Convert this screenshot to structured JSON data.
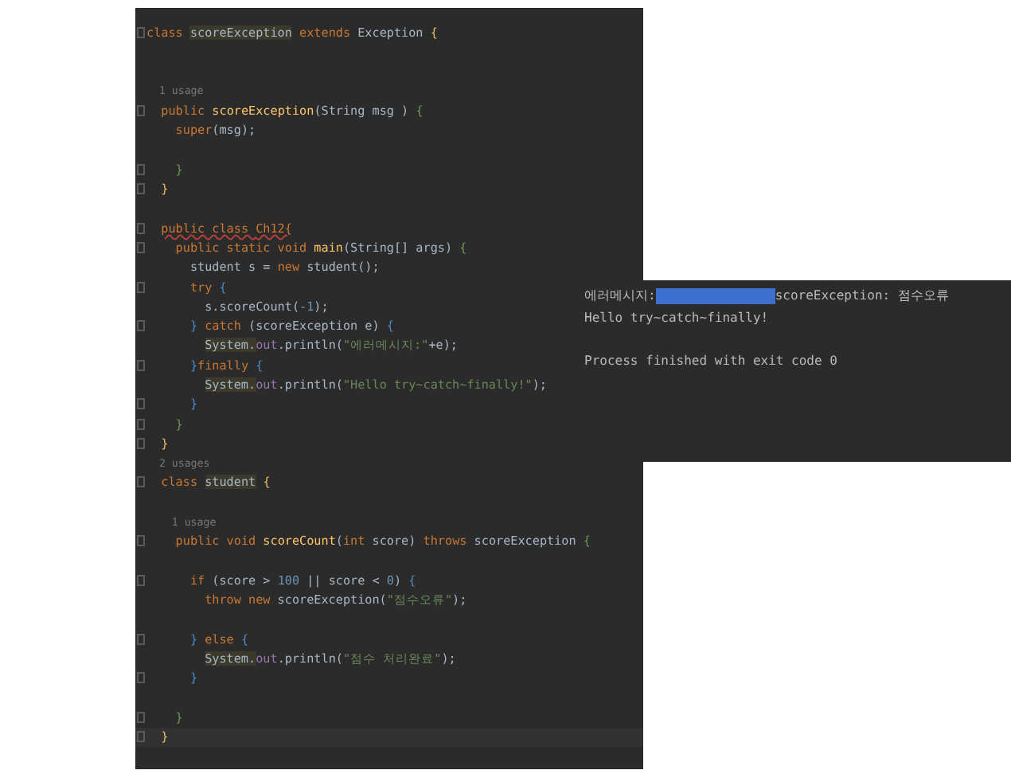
{
  "editor": {
    "lines": [
      {
        "kind": "code",
        "fold": true,
        "tokens": [
          {
            "text": "class ",
            "kind": "kw"
          },
          {
            "text": "scoreException",
            "kind": "mark"
          },
          {
            "text": " extends ",
            "kind": "kw"
          },
          {
            "text": "Exception ",
            "kind": "plain"
          },
          {
            "text": "{",
            "kind": "brace1"
          }
        ]
      },
      {
        "kind": "blank"
      },
      {
        "kind": "blank"
      },
      {
        "kind": "hint",
        "tokens": [
          {
            "text": "  1 usage",
            "kind": "hint"
          }
        ]
      },
      {
        "kind": "code",
        "fold": true,
        "tokens": [
          {
            "text": "  public ",
            "kind": "kw"
          },
          {
            "text": "scoreException",
            "kind": "fn"
          },
          {
            "text": "(String msg ) ",
            "kind": "plain"
          },
          {
            "text": "{",
            "kind": "brace2"
          }
        ]
      },
      {
        "kind": "code",
        "tokens": [
          {
            "text": "    super",
            "kind": "kw"
          },
          {
            "text": "(msg);",
            "kind": "plain"
          }
        ]
      },
      {
        "kind": "blank"
      },
      {
        "kind": "code",
        "fold": true,
        "tokens": [
          {
            "text": "    }",
            "kind": "brace2"
          }
        ]
      },
      {
        "kind": "code",
        "fold": true,
        "tokens": [
          {
            "text": "  }",
            "kind": "brace1"
          }
        ]
      },
      {
        "kind": "blank"
      },
      {
        "kind": "code",
        "fold": true,
        "tokens": [
          {
            "text": "  public class ",
            "kind": "err"
          },
          {
            "text": "Ch12{",
            "kind": "err"
          }
        ]
      },
      {
        "kind": "code",
        "fold": true,
        "tokens": [
          {
            "text": "    public static void ",
            "kind": "kw"
          },
          {
            "text": "main",
            "kind": "fn"
          },
          {
            "text": "(String[] args) ",
            "kind": "plain"
          },
          {
            "text": "{",
            "kind": "brace2"
          }
        ]
      },
      {
        "kind": "code",
        "tokens": [
          {
            "text": "      student s = ",
            "kind": "plain"
          },
          {
            "text": "new ",
            "kind": "kw"
          },
          {
            "text": "student();",
            "kind": "plain"
          }
        ]
      },
      {
        "kind": "code",
        "fold": true,
        "tokens": [
          {
            "text": "      try ",
            "kind": "kw"
          },
          {
            "text": "{",
            "kind": "brace3"
          }
        ]
      },
      {
        "kind": "code",
        "tokens": [
          {
            "text": "        s.scoreCount(",
            "kind": "plain"
          },
          {
            "text": "-1",
            "kind": "num"
          },
          {
            "text": ");",
            "kind": "plain"
          }
        ]
      },
      {
        "kind": "code",
        "fold": true,
        "tokens": [
          {
            "text": "      } ",
            "kind": "brace3"
          },
          {
            "text": "catch ",
            "kind": "kw"
          },
          {
            "text": "(scoreException e) ",
            "kind": "plain"
          },
          {
            "text": "{",
            "kind": "brace3"
          }
        ]
      },
      {
        "kind": "code",
        "tokens": [
          {
            "text": "        System.",
            "kind": "mark"
          },
          {
            "text": "out",
            "kind": "field"
          },
          {
            "text": ".println(",
            "kind": "plain"
          },
          {
            "text": "\"에러메시지:\"",
            "kind": "str"
          },
          {
            "text": "+e);",
            "kind": "plain"
          }
        ]
      },
      {
        "kind": "code",
        "fold": true,
        "tokens": [
          {
            "text": "      }",
            "kind": "brace3"
          },
          {
            "text": "finally ",
            "kind": "kw"
          },
          {
            "text": "{",
            "kind": "brace3"
          }
        ]
      },
      {
        "kind": "code",
        "tokens": [
          {
            "text": "        System.",
            "kind": "mark"
          },
          {
            "text": "out",
            "kind": "field"
          },
          {
            "text": ".println(",
            "kind": "plain"
          },
          {
            "text": "\"Hello try~catch~finally!\"",
            "kind": "str"
          },
          {
            "text": ");",
            "kind": "plain"
          }
        ]
      },
      {
        "kind": "code",
        "fold": true,
        "tokens": [
          {
            "text": "      }",
            "kind": "brace3"
          }
        ]
      },
      {
        "kind": "code",
        "fold": true,
        "tokens": [
          {
            "text": "    }",
            "kind": "brace2"
          }
        ]
      },
      {
        "kind": "code",
        "fold": true,
        "tokens": [
          {
            "text": "  }",
            "kind": "brace1"
          }
        ]
      },
      {
        "kind": "hint",
        "tokens": [
          {
            "text": "  2 usages",
            "kind": "hint"
          }
        ]
      },
      {
        "kind": "code",
        "fold": true,
        "tokens": [
          {
            "text": "  class ",
            "kind": "kw"
          },
          {
            "text": "student",
            "kind": "mark"
          },
          {
            "text": " {",
            "kind": "brace1"
          }
        ]
      },
      {
        "kind": "blank"
      },
      {
        "kind": "hint",
        "tokens": [
          {
            "text": "    1 usage",
            "kind": "hint"
          }
        ]
      },
      {
        "kind": "code",
        "fold": true,
        "tokens": [
          {
            "text": "    public void ",
            "kind": "kw"
          },
          {
            "text": "scoreCount",
            "kind": "fn"
          },
          {
            "text": "(",
            "kind": "plain"
          },
          {
            "text": "int ",
            "kind": "kw"
          },
          {
            "text": "score) ",
            "kind": "plain"
          },
          {
            "text": "throws ",
            "kind": "kw"
          },
          {
            "text": "scoreException ",
            "kind": "plain"
          },
          {
            "text": "{",
            "kind": "brace2"
          }
        ]
      },
      {
        "kind": "blank"
      },
      {
        "kind": "code",
        "fold": true,
        "tokens": [
          {
            "text": "      if ",
            "kind": "kw"
          },
          {
            "text": "(score > ",
            "kind": "plain"
          },
          {
            "text": "100",
            "kind": "num"
          },
          {
            "text": " || score < ",
            "kind": "plain"
          },
          {
            "text": "0",
            "kind": "num"
          },
          {
            "text": ") ",
            "kind": "plain"
          },
          {
            "text": "{",
            "kind": "brace3"
          }
        ]
      },
      {
        "kind": "code",
        "tokens": [
          {
            "text": "        throw new ",
            "kind": "kw"
          },
          {
            "text": "scoreException(",
            "kind": "plain"
          },
          {
            "text": "\"점수오류\"",
            "kind": "str"
          },
          {
            "text": ");",
            "kind": "plain"
          }
        ]
      },
      {
        "kind": "blank"
      },
      {
        "kind": "code",
        "fold": true,
        "tokens": [
          {
            "text": "      } ",
            "kind": "brace3"
          },
          {
            "text": "else ",
            "kind": "kw"
          },
          {
            "text": "{",
            "kind": "brace3"
          }
        ]
      },
      {
        "kind": "code",
        "tokens": [
          {
            "text": "        System.",
            "kind": "mark"
          },
          {
            "text": "out",
            "kind": "field"
          },
          {
            "text": ".println(",
            "kind": "plain"
          },
          {
            "text": "\"점수 처리완료\"",
            "kind": "str"
          },
          {
            "text": ");",
            "kind": "plain"
          }
        ]
      },
      {
        "kind": "code",
        "fold": true,
        "tokens": [
          {
            "text": "      }",
            "kind": "brace3"
          }
        ]
      },
      {
        "kind": "blank"
      },
      {
        "kind": "code",
        "fold": true,
        "tokens": [
          {
            "text": "    }",
            "kind": "brace2"
          }
        ]
      },
      {
        "kind": "code",
        "fold": true,
        "current": true,
        "tokens": [
          {
            "text": "  }",
            "kind": "brace1"
          }
        ]
      }
    ]
  },
  "console": {
    "lines": [
      {
        "text": "에러메시지:",
        "redacted": true,
        "after": "scoreException: 점수오류"
      },
      {
        "text": "Hello try~catch~finally!"
      },
      {
        "text": "Process finished with exit code 0"
      }
    ]
  }
}
